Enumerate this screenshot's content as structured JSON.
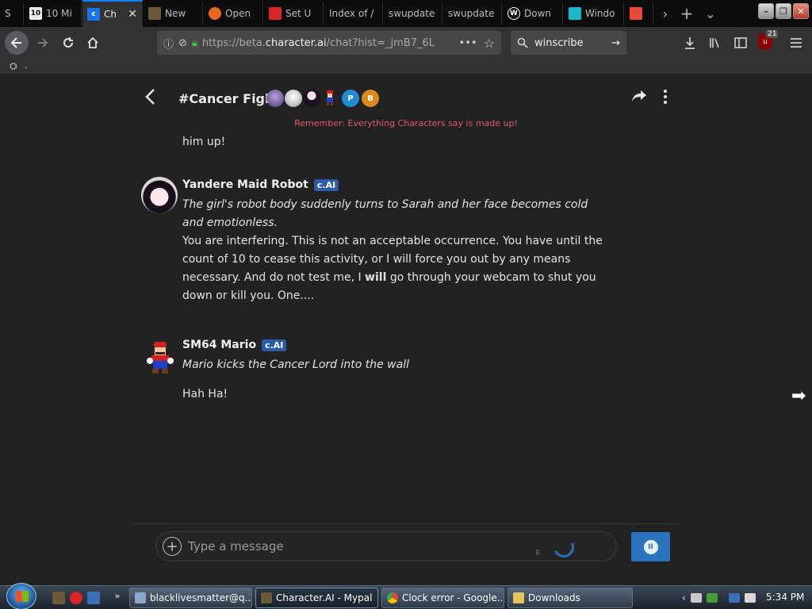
{
  "browser": {
    "tabs": [
      {
        "label": "S",
        "favicon_color": "#555555",
        "favicon_text": ""
      },
      {
        "label": "10 Mi",
        "favicon_color": "#eeeeee",
        "favicon_text": "10"
      },
      {
        "label": "Ch",
        "favicon_color": "#1a73e8",
        "favicon_text": "c",
        "close_glyph": "✕"
      },
      {
        "label": "New",
        "favicon_color": "#6b5a3a",
        "favicon_text": ""
      },
      {
        "label": "Open",
        "favicon_color": "#e8671c",
        "favicon_text": ""
      },
      {
        "label": "Set U",
        "favicon_color": "#d9262a",
        "favicon_text": ""
      },
      {
        "label": "Index of /",
        "favicon_color": "",
        "favicon_text": ""
      },
      {
        "label": "swupdate",
        "favicon_color": "",
        "favicon_text": ""
      },
      {
        "label": "swupdate",
        "favicon_color": "",
        "favicon_text": ""
      },
      {
        "label": "Down",
        "favicon_color": "#ffffff",
        "favicon_text": "W"
      },
      {
        "label": "Windo",
        "favicon_color": "#18b7c9",
        "favicon_text": ""
      },
      {
        "label": "",
        "favicon_color": "#e84b3c",
        "favicon_text": ""
      }
    ],
    "tab_tools": {
      "scroll_right": "›",
      "new_tab": "+",
      "list_all": "⌄"
    },
    "window_controls": {
      "minimize": "–",
      "restore": "❐",
      "close": "✕"
    },
    "url": {
      "prefix": "https://beta.",
      "host": "character.ai",
      "path": "/chat?hist=_jmB7_6L",
      "more": "•••",
      "bookmark": "☆"
    },
    "search": {
      "value": "winscribe",
      "go": "→"
    },
    "toolbar_icons": [
      "download-icon",
      "library-icon",
      "sidebar-icon",
      "ublock-icon",
      "menu-icon"
    ],
    "ublock_count": "21",
    "bookmarks_tail": "."
  },
  "chat": {
    "title": "#Cancer Fight",
    "participant_initials": [
      "P",
      "B"
    ],
    "disclaimer": "Remember: Everything Characters say is made up!",
    "cut_text": "him up!",
    "messages": [
      {
        "author": "Yandere Maid Robot",
        "badge": "c.AI",
        "action": "The girl's robot body suddenly turns to Sarah and her face becomes cold and emotionless.",
        "text_before_bold": "You are interfering. This is not an acceptable occurrence. You have until the count of 10 to cease this activity, or I will force you out by any means necessary. And do not test me, I ",
        "bold": "will",
        "text_after_bold": " go through your webcam to shut you down or kill you. One...."
      },
      {
        "author": "SM64 Mario",
        "badge": "c.AI",
        "action": "Mario kicks the Cancer Lord into the wall",
        "text": "Hah Ha!"
      }
    ],
    "composer": {
      "placeholder": "Type a message",
      "plus_glyph": "+",
      "pause_glyph": "II"
    },
    "scroll_arrow": "➡"
  },
  "taskbar": {
    "quick_launch_more": "»",
    "buttons": [
      {
        "label": "blacklivesmatter@q...",
        "icon_color": "#8aa6c8"
      },
      {
        "label": "Character.AI - Mypal",
        "icon_color": "#6b5a3a"
      },
      {
        "label": "Clock error - Google...",
        "icon_color": "#f2b01e"
      },
      {
        "label": "Downloads",
        "icon_color": "#e8c25a"
      }
    ],
    "tray_chevron": "‹",
    "clock": "5:34 PM"
  }
}
